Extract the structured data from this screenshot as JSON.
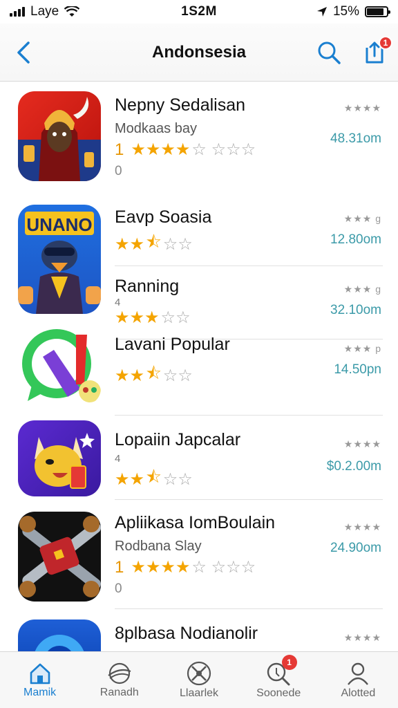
{
  "status_bar": {
    "carrier": "Laye",
    "time": "1S2M",
    "battery": "15%"
  },
  "nav": {
    "title": "Andonsesia",
    "notification_count": "1"
  },
  "apps": [
    {
      "title": "Nepny Sedalisan",
      "subtitle": "Modkaas bay",
      "rating_num": "1",
      "stars": 4,
      "count": "0",
      "size": "48.31om",
      "meta_stars": "★★★★"
    },
    {
      "title": "Eavp Soasia",
      "rating_num": "",
      "stars": 2.5,
      "size": "12.80om",
      "meta_stars": "★★★ g"
    },
    {
      "title": "Ranning",
      "rating_num": "4",
      "stars": 3,
      "size": "32.10om",
      "meta_stars": "★★★ g"
    },
    {
      "title": "Lavani Popular",
      "rating_num": "",
      "stars": 2.5,
      "size": "14.50pn",
      "meta_stars": "★★★ p"
    },
    {
      "title": "Lopaiin Japcalar",
      "rating_num": "4",
      "stars": 2.5,
      "size": "$0.2.00m",
      "meta_stars": "★★★★"
    },
    {
      "title": "Apliikasa IomBoulain",
      "subtitle": "Rodbana Slay",
      "rating_num": "1",
      "stars": 4,
      "count": "0",
      "size": "24.90om",
      "meta_stars": "★★★★"
    },
    {
      "title": "8plbasa Nodianolir",
      "size": "",
      "meta_stars": "★★★★"
    }
  ],
  "tabs": [
    {
      "label": "Mamik",
      "icon": "home-icon",
      "active": true
    },
    {
      "label": "Ranadh",
      "icon": "planet-icon"
    },
    {
      "label": "Llaarlek",
      "icon": "tools-icon"
    },
    {
      "label": "Soonede",
      "icon": "search-icon",
      "badge": "1"
    },
    {
      "label": "Alotted",
      "icon": "person-icon"
    }
  ],
  "colors": {
    "accent": "#1a7fd0",
    "star": "#f4a400",
    "size_text": "#3b9aa8",
    "badge": "#e53935"
  }
}
